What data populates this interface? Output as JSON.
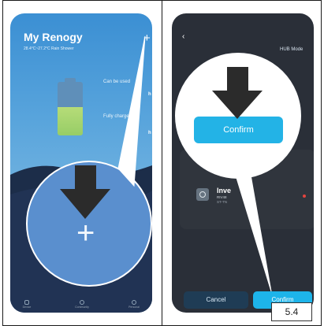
{
  "left_screen": {
    "title": "My Renogy",
    "weather": "28.4°C~27.2°C  Rain Shower",
    "can_be_used": "Can be used",
    "fully_charged": "Fully charged in",
    "hour_unit_1": "h",
    "hour_unit_2": "h",
    "plus_icon": "+",
    "zoom_plus_icon": "+",
    "tabs": [
      {
        "label": "Device"
      },
      {
        "label": "Community"
      },
      {
        "label": "Personal"
      }
    ]
  },
  "right_screen": {
    "back_icon": "‹",
    "hub_mode": "HUB Mode",
    "faint_text": "ce",
    "device": {
      "name": "Inve",
      "model": "RIV48",
      "serial": "ST-TN"
    },
    "cancel_label": "Cancel",
    "confirm_label": "Confirm",
    "zoom_confirm_label": "Confirm"
  },
  "step_label": "5.4",
  "colors": {
    "accent_blue": "#23b3e6",
    "dark_bg": "#2a2f38",
    "arrow": "#2b2b2b",
    "status_red": "#e4443e"
  }
}
